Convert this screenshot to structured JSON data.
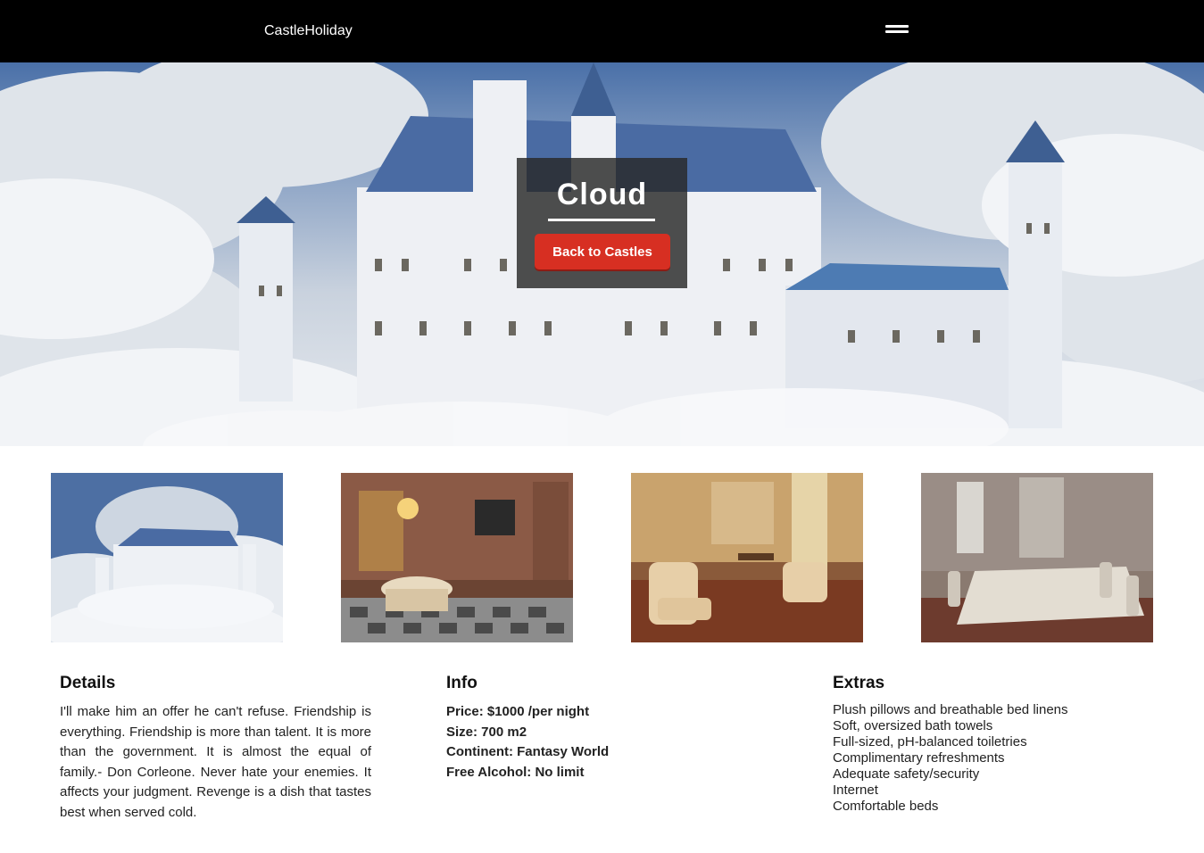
{
  "nav": {
    "brand": "CastleHoliday",
    "menu_icon": "hamburger-icon"
  },
  "hero": {
    "title": "Cloud",
    "button_label": "Back to Castles"
  },
  "gallery": [
    {
      "subject": "castle-in-clouds"
    },
    {
      "subject": "dining-room-chandelier"
    },
    {
      "subject": "salon-armchairs"
    },
    {
      "subject": "banquet-hall"
    }
  ],
  "details": {
    "heading": "Details",
    "text": "I'll make him an offer he can't refuse. Friendship is everything. Friendship is more than talent. It is more than the government. It is almost the equal of family.- Don Corleone. Never hate your enemies. It affects your judgment. Revenge is a dish that tastes best when served cold."
  },
  "info": {
    "heading": "Info",
    "rows": [
      "Price: $1000 /per night",
      "Size: 700 m2",
      "Continent: Fantasy World",
      "Free Alcohol: No limit"
    ]
  },
  "extras": {
    "heading": "Extras",
    "items": [
      "Plush pillows and breathable bed linens",
      "Soft, oversized bath towels",
      "Full-sized, pH-balanced toiletries",
      "Complimentary refreshments",
      "Adequate safety/security",
      "Internet",
      "Comfortable beds"
    ]
  },
  "colors": {
    "nav_bg": "#000000",
    "button_red": "#d72f22",
    "overlay": "#282828"
  }
}
